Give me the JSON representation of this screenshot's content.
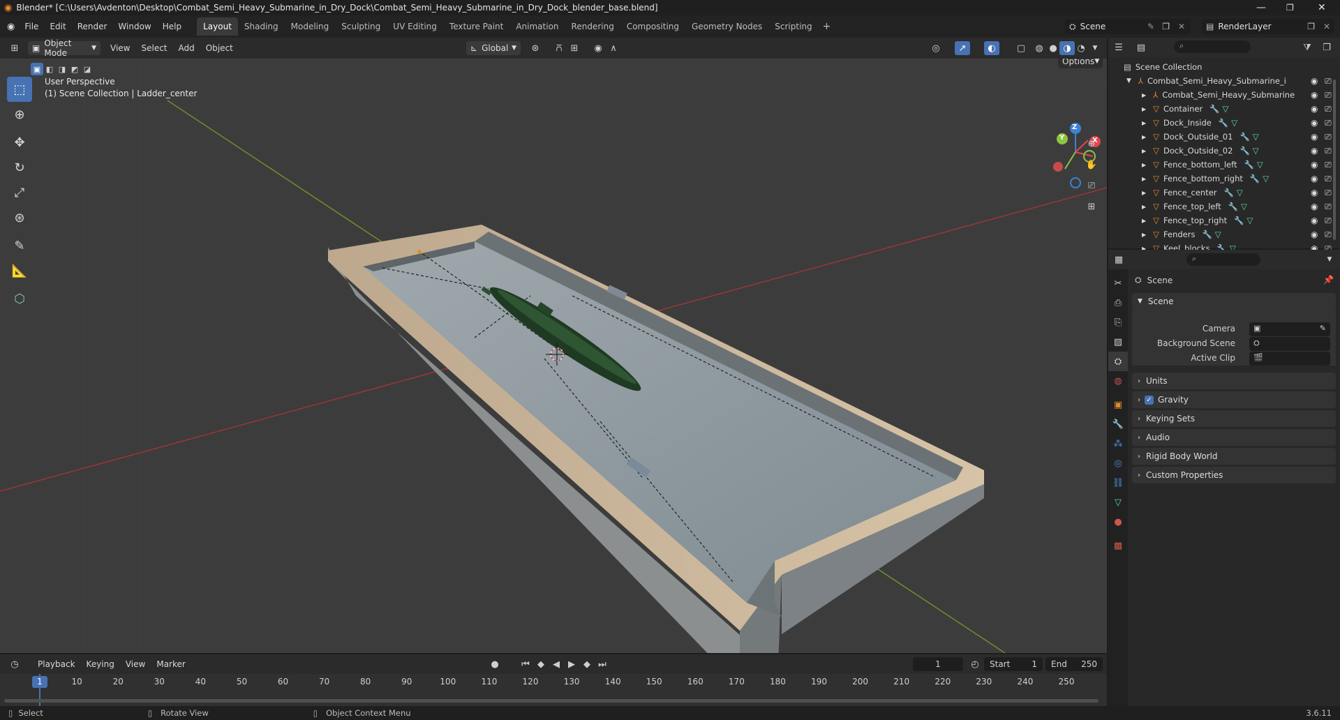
{
  "title": "Blender* [C:\\Users\\Avdenton\\Desktop\\Combat_Semi_Heavy_Submarine_in_Dry_Dock\\Combat_Semi_Heavy_Submarine_in_Dry_Dock_blender_base.blend]",
  "menu": [
    "File",
    "Edit",
    "Render",
    "Window",
    "Help"
  ],
  "workspaces": [
    "Layout",
    "Shading",
    "Modeling",
    "Sculpting",
    "UV Editing",
    "Texture Paint",
    "Animation",
    "Rendering",
    "Compositing",
    "Geometry Nodes",
    "Scripting"
  ],
  "active_workspace": "Layout",
  "scene_name": "Scene",
  "render_layer": "RenderLayer",
  "viewport": {
    "mode": "Object Mode",
    "menus": [
      "View",
      "Select",
      "Add",
      "Object"
    ],
    "transform_orientation": "Global",
    "options_label": "Options",
    "info_line1": "User Perspective",
    "info_line2": "(1) Scene Collection | Ladder_center",
    "gizmo": {
      "x": "X",
      "y": "Y",
      "z": "Z"
    }
  },
  "outliner": {
    "root": "Scene Collection",
    "collection": "Combat_Semi_Heavy_Submarine_in_Dr",
    "items": [
      "Combat_Semi_Heavy_Submarine",
      "Container",
      "Dock_Inside",
      "Dock_Outside_01",
      "Dock_Outside_02",
      "Fence_bottom_left",
      "Fence_bottom_right",
      "Fence_center",
      "Fence_top_left",
      "Fence_top_right",
      "Fenders",
      "Keel_blocks"
    ]
  },
  "properties": {
    "context": "Scene",
    "panel_title": "Scene",
    "fields": [
      {
        "label": "Camera",
        "value": ""
      },
      {
        "label": "Background Scene",
        "value": ""
      },
      {
        "label": "Active Clip",
        "value": ""
      }
    ],
    "panels": [
      "Units",
      "Gravity",
      "Keying Sets",
      "Audio",
      "Rigid Body World",
      "Custom Properties"
    ],
    "gravity_checked": true
  },
  "timeline": {
    "menus": [
      "Playback",
      "Keying",
      "View",
      "Marker"
    ],
    "current_frame": "1",
    "start_label": "Start",
    "start": "1",
    "end_label": "End",
    "end": "250",
    "ticks": [
      "1",
      "10",
      "20",
      "30",
      "40",
      "50",
      "60",
      "70",
      "80",
      "90",
      "100",
      "110",
      "120",
      "130",
      "140",
      "150",
      "160",
      "170",
      "180",
      "190",
      "200",
      "210",
      "220",
      "230",
      "240",
      "250"
    ]
  },
  "status": {
    "select": "Select",
    "rotate": "Rotate View",
    "context_menu": "Object Context Menu",
    "version": "3.6.11"
  },
  "colors": {
    "accent": "#4772b3",
    "x_axis": "#e2464f",
    "y_axis": "#8cc63e",
    "z_axis": "#3d82d6",
    "object": "#e48b2e",
    "mesh": "#5fd9a6"
  }
}
